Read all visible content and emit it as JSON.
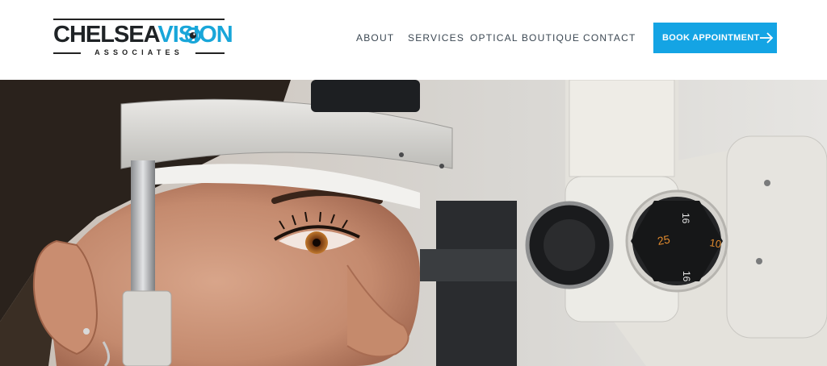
{
  "logo": {
    "name_part1": "CHELSEA",
    "name_part2": "VISION",
    "subtitle": "ASSOCIATES",
    "icon": "eye-icon",
    "colors": {
      "dark": "#1f2326",
      "accent": "#18a6d9"
    }
  },
  "nav": {
    "items": [
      {
        "label": "ABOUT"
      },
      {
        "label": "SERVICES"
      },
      {
        "label": "OPTICAL BOUTIQUE"
      },
      {
        "label": "CONTACT"
      }
    ]
  },
  "cta": {
    "label": "BOOK APPOINTMENT",
    "icon": "arrow-right-icon",
    "color": "#14a4e4"
  },
  "hero": {
    "description_icon": "eye-exam-photo",
    "dial_numbers": [
      "16",
      "25",
      "10",
      "16"
    ]
  }
}
